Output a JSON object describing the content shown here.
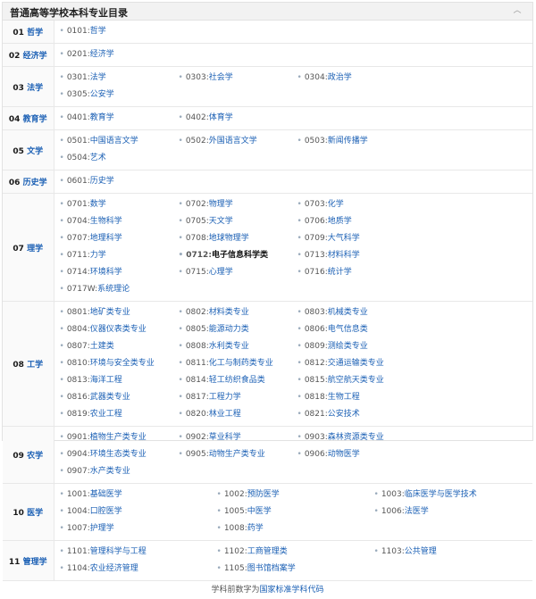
{
  "header": {
    "title": "普通高等学校本科专业目录",
    "collapse_icon": "chevron-up-icon"
  },
  "disciplines": [
    {
      "code": "01",
      "name": "哲学",
      "cols": 4,
      "majors": [
        {
          "code": "0101",
          "name": "哲学"
        }
      ]
    },
    {
      "code": "02",
      "name": "经济学",
      "cols": 4,
      "majors": [
        {
          "code": "0201",
          "name": "经济学"
        }
      ]
    },
    {
      "code": "03",
      "name": "法学",
      "cols": 4,
      "majors": [
        {
          "code": "0301",
          "name": "法学"
        },
        {
          "code": "0303",
          "name": "社会学"
        },
        {
          "code": "0304",
          "name": "政治学"
        },
        {
          "code": "0305",
          "name": "公安学"
        }
      ]
    },
    {
      "code": "04",
      "name": "教育学",
      "cols": 4,
      "majors": [
        {
          "code": "0401",
          "name": "教育学"
        },
        {
          "code": "0402",
          "name": "体育学"
        }
      ]
    },
    {
      "code": "05",
      "name": "文学",
      "cols": 4,
      "majors": [
        {
          "code": "0501",
          "name": "中国语言文学"
        },
        {
          "code": "0502",
          "name": "外国语言文学"
        },
        {
          "code": "0503",
          "name": "新闻传播学"
        },
        {
          "code": "0504",
          "name": "艺术"
        }
      ]
    },
    {
      "code": "06",
      "name": "历史学",
      "cols": 4,
      "majors": [
        {
          "code": "0601",
          "name": "历史学"
        }
      ]
    },
    {
      "code": "07",
      "name": "理学",
      "cols": 4,
      "majors": [
        {
          "code": "0701",
          "name": "数学"
        },
        {
          "code": "0702",
          "name": "物理学"
        },
        {
          "code": "0703",
          "name": "化学"
        },
        {
          "code": "0704",
          "name": "生物科学"
        },
        {
          "code": "0705",
          "name": "天文学"
        },
        {
          "code": "0706",
          "name": "地质学"
        },
        {
          "code": "0707",
          "name": "地理科学"
        },
        {
          "code": "0708",
          "name": "地球物理学"
        },
        {
          "code": "0709",
          "name": "大气科学"
        },
        {
          "code": "0711",
          "name": "力学"
        },
        {
          "code": "0712",
          "name": "电子信息科学类",
          "bold": true
        },
        {
          "code": "0713",
          "name": "材料科学"
        },
        {
          "code": "0714",
          "name": "环境科学"
        },
        {
          "code": "0715",
          "name": "心理学"
        },
        {
          "code": "0716",
          "name": "统计学"
        },
        {
          "code": "0717W",
          "name": "系统理论"
        }
      ]
    },
    {
      "code": "08",
      "name": "工学",
      "cols": 4,
      "majors": [
        {
          "code": "0801",
          "name": "地矿类专业"
        },
        {
          "code": "0802",
          "name": "材料类专业"
        },
        {
          "code": "0803",
          "name": "机械类专业"
        },
        {
          "code": "0804",
          "name": "仪器仪表类专业"
        },
        {
          "code": "0805",
          "name": "能源动力类"
        },
        {
          "code": "0806",
          "name": "电气信息类"
        },
        {
          "code": "0807",
          "name": "土建类"
        },
        {
          "code": "0808",
          "name": "水利类专业"
        },
        {
          "code": "0809",
          "name": "测绘类专业"
        },
        {
          "code": "0810",
          "name": "环境与安全类专业"
        },
        {
          "code": "0811",
          "name": "化工与制药类专业"
        },
        {
          "code": "0812",
          "name": "交通运输类专业"
        },
        {
          "code": "0813",
          "name": "海洋工程"
        },
        {
          "code": "0814",
          "name": "轻工纺织食品类"
        },
        {
          "code": "0815",
          "name": "航空航天类专业"
        },
        {
          "code": "0816",
          "name": "武器类专业"
        },
        {
          "code": "0817",
          "name": "工程力学"
        },
        {
          "code": "0818",
          "name": "生物工程"
        },
        {
          "code": "0819",
          "name": "农业工程"
        },
        {
          "code": "0820",
          "name": "林业工程"
        },
        {
          "code": "0821",
          "name": "公安技术"
        }
      ]
    },
    {
      "code": "09",
      "name": "农学",
      "cols": 4,
      "majors": [
        {
          "code": "0901",
          "name": "植物生产类专业"
        },
        {
          "code": "0902",
          "name": "草业科学"
        },
        {
          "code": "0903",
          "name": "森林资源类专业"
        },
        {
          "code": "0904",
          "name": "环境生态类专业"
        },
        {
          "code": "0905",
          "name": "动物生产类专业"
        },
        {
          "code": "0906",
          "name": "动物医学"
        },
        {
          "code": "0907",
          "name": "水产类专业"
        }
      ]
    },
    {
      "code": "10",
      "name": "医学",
      "cols": 3,
      "majors": [
        {
          "code": "1001",
          "name": "基础医学"
        },
        {
          "code": "1002",
          "name": "预防医学"
        },
        {
          "code": "1003",
          "name": "临床医学与医学技术"
        },
        {
          "code": "1004",
          "name": "口腔医学"
        },
        {
          "code": "1005",
          "name": "中医学"
        },
        {
          "code": "1006",
          "name": "法医学"
        },
        {
          "code": "1007",
          "name": "护理学"
        },
        {
          "code": "1008",
          "name": "药学"
        }
      ]
    },
    {
      "code": "11",
      "name": "管理学",
      "cols": 3,
      "majors": [
        {
          "code": "1101",
          "name": "管理科学与工程"
        },
        {
          "code": "1102",
          "name": "工商管理类"
        },
        {
          "code": "1103",
          "name": "公共管理"
        },
        {
          "code": "1104",
          "name": "农业经济管理"
        },
        {
          "code": "1105",
          "name": "图书馆档案学"
        }
      ]
    }
  ],
  "footer": {
    "prefix": "学科前数字为",
    "link": "国家标准学科代码"
  }
}
